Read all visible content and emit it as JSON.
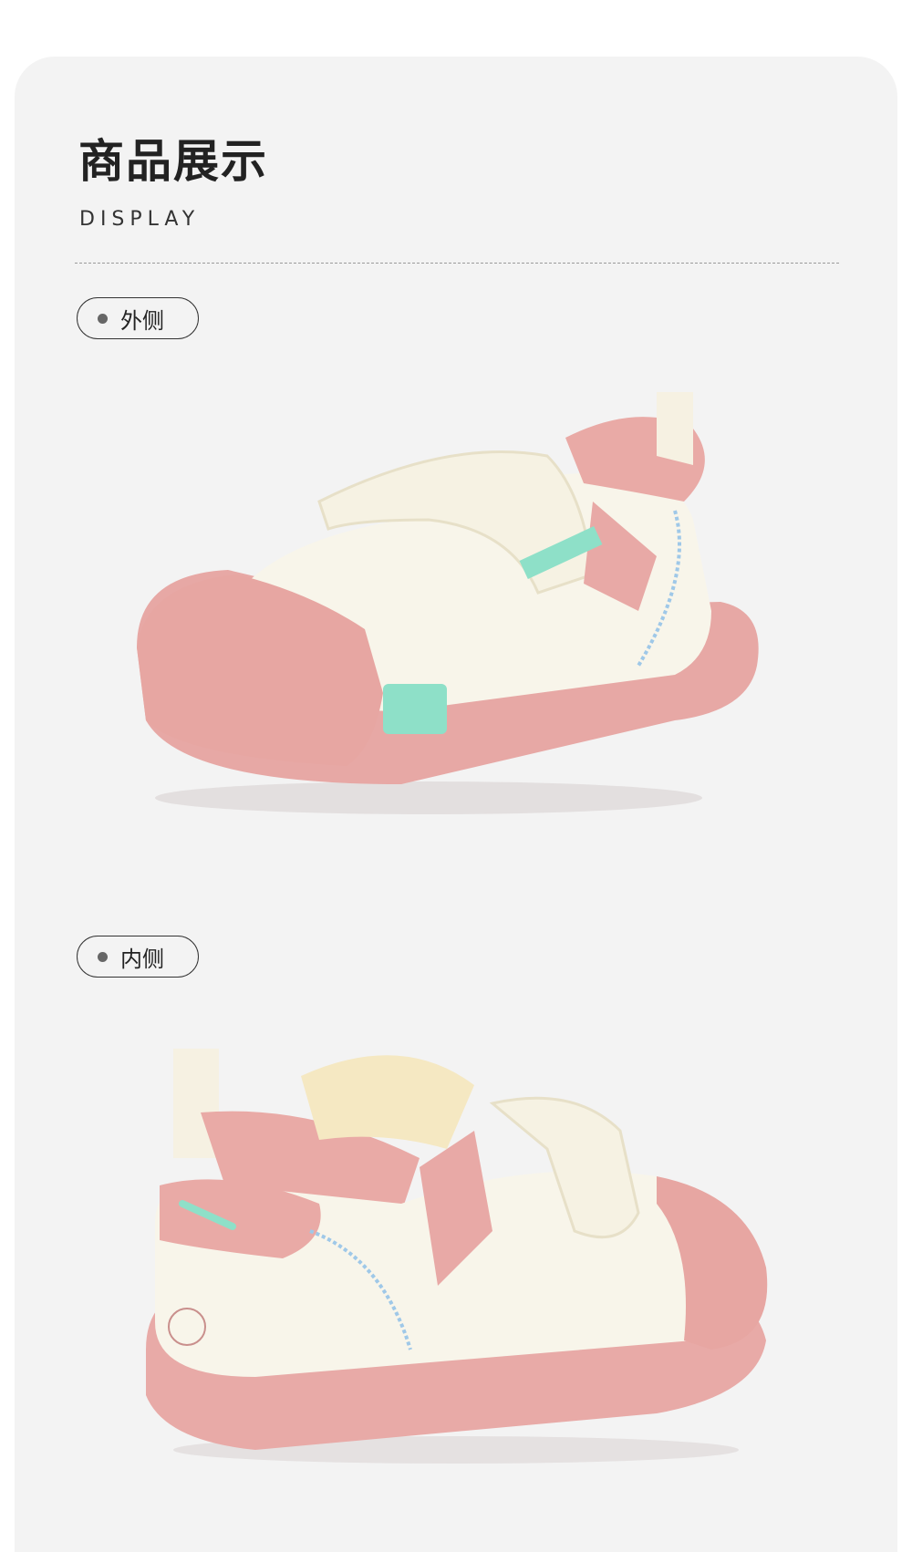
{
  "section": {
    "title": "商品展示",
    "subtitle": "DISPLAY"
  },
  "views": [
    {
      "label": "外侧",
      "image": "baby-shoe-outer-side"
    },
    {
      "label": "内侧",
      "image": "baby-shoe-inner-side"
    }
  ],
  "colors": {
    "background": "#f3f3f3",
    "shoe_body": "#f8f5ea",
    "shoe_pink": "#e8a9a6",
    "accent_mint": "#8ee0c8",
    "stitch_blue": "#9fc8e8"
  }
}
